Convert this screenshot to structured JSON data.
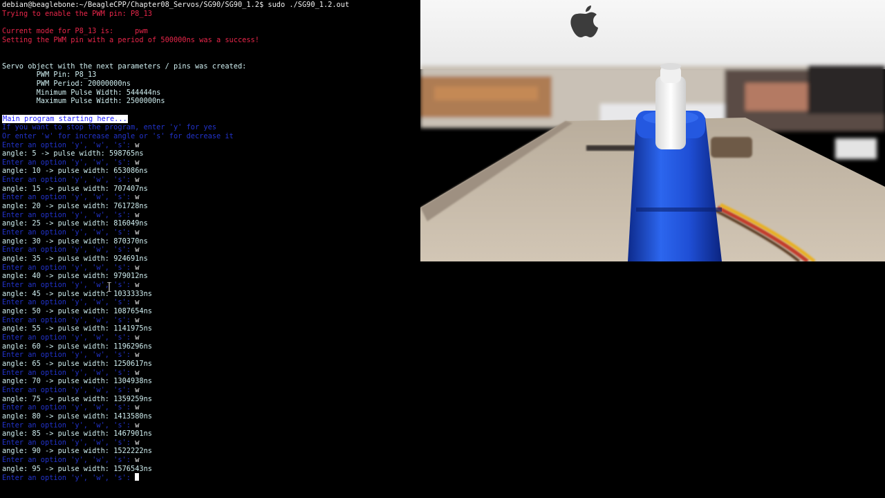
{
  "terminal": {
    "prompt": {
      "user_host": "debian@beaglebone",
      "path": ":~/BeagleCPP/Chapter08_Servos/SG90/SG90_1.2$",
      "command": " sudo ./SG90_1.2.out"
    },
    "pwm_lines": [
      "Trying to enable the PWM pin: P8_13",
      "",
      "Current mode for P8_13 is:     pwm",
      "Setting the PWM pin with a period of 500000ns was a success!",
      "",
      ""
    ],
    "servo_lines": [
      "Servo object with the next parameters / pins was created:",
      "        PWM Pin: P8_13",
      "        PWM Period: 20000000ns",
      "        Minimum Pulse Width: 544444ns",
      "        Maximum Pulse Width: 2500000ns",
      ""
    ],
    "main_banner": "Main program starting here...",
    "instructions": [
      "If you want to stop the program, enter 'y' for yes",
      "Or enter 'w' for increase angle or 's' for decrease it"
    ],
    "option_prompt": "Enter an option 'y', 'w', 's': ",
    "option_input": "w",
    "readings": [
      {
        "angle": "5",
        "pulse": "598765ns"
      },
      {
        "angle": "10",
        "pulse": "653086ns"
      },
      {
        "angle": "15",
        "pulse": "707407ns"
      },
      {
        "angle": "20",
        "pulse": "761728ns"
      },
      {
        "angle": "25",
        "pulse": "816049ns"
      },
      {
        "angle": "30",
        "pulse": "870370ns"
      },
      {
        "angle": "35",
        "pulse": "924691ns"
      },
      {
        "angle": "40",
        "pulse": "979012ns"
      },
      {
        "angle": "45",
        "pulse": "1033333ns"
      },
      {
        "angle": "50",
        "pulse": "1087654ns"
      },
      {
        "angle": "55",
        "pulse": "1141975ns"
      },
      {
        "angle": "60",
        "pulse": "1196296ns"
      },
      {
        "angle": "65",
        "pulse": "1250617ns"
      },
      {
        "angle": "70",
        "pulse": "1304938ns"
      },
      {
        "angle": "75",
        "pulse": "1359259ns"
      },
      {
        "angle": "80",
        "pulse": "1413580ns"
      },
      {
        "angle": "85",
        "pulse": "1467901ns"
      },
      {
        "angle": "90",
        "pulse": "1522222ns"
      },
      {
        "angle": "95",
        "pulse": "1576543ns"
      }
    ],
    "reading_template": {
      "prefix": "angle: ",
      "middle": " -> pulse width: "
    }
  },
  "webcam": {
    "description_icons": [
      "apple-logo-icon",
      "servo-motor-icon"
    ],
    "colors": {
      "wall": "#f4f4f4",
      "servo": "#1f4fd6",
      "platform": "#cbbfae"
    }
  },
  "colors": {
    "background": "#000000",
    "text": "#f2f2f2",
    "error_red": "#e8264a",
    "cyan": "#cfeef0",
    "dim_blue": "#2233cc",
    "highlight_fg": "#1a1aff"
  }
}
